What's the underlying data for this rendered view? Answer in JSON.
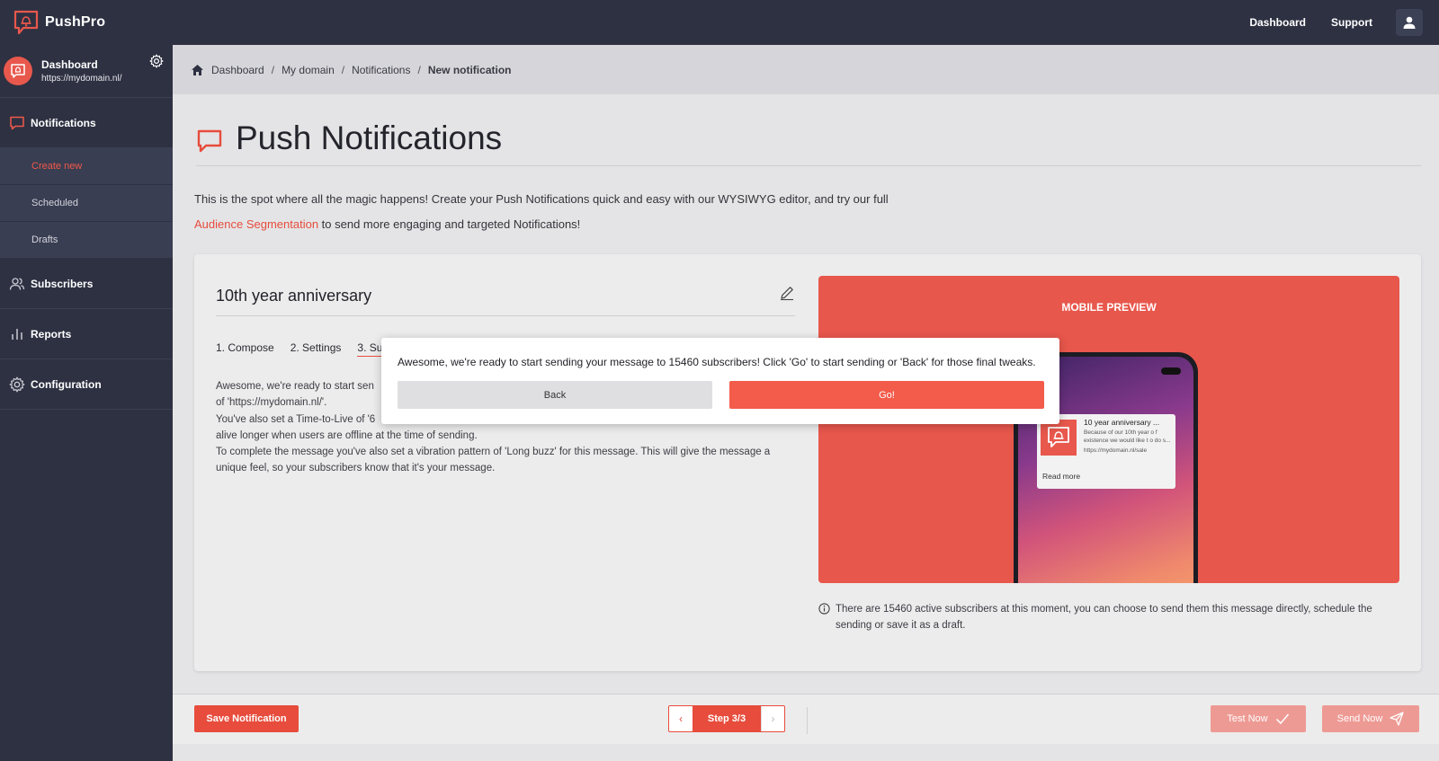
{
  "app": {
    "name": "PushPro"
  },
  "topnav": {
    "dashboard": "Dashboard",
    "support": "Support"
  },
  "sidebar": {
    "site_name": "Dashboard",
    "site_url": "https://mydomain.nl/",
    "sections": [
      {
        "label": "Notifications",
        "icon": "chat-bubble-icon"
      },
      {
        "label": "Subscribers",
        "icon": "users-icon"
      },
      {
        "label": "Reports",
        "icon": "bar-chart-icon"
      },
      {
        "label": "Configuration",
        "icon": "gear-icon"
      }
    ],
    "notification_items": [
      {
        "label": "Create new",
        "active": true
      },
      {
        "label": "Scheduled",
        "active": false
      },
      {
        "label": "Drafts",
        "active": false
      }
    ]
  },
  "breadcrumb": {
    "items": [
      "Dashboard",
      "My domain",
      "Notifications"
    ],
    "current": "New notification",
    "separator": "/"
  },
  "page": {
    "title": "Push Notifications",
    "intro_line1": "This is the spot where all the magic happens! Create your Push Notifications quick and easy with our WYSIWYG editor, and try our full",
    "intro_link": "Audience Segmentation",
    "intro_line2": " to send more engaging and targeted Notifications!"
  },
  "editor": {
    "notification_title": "10th year anniversary",
    "steps": [
      {
        "label": "1. Compose",
        "active": false
      },
      {
        "label": "2. Settings",
        "active": false
      },
      {
        "label": "3. Su",
        "active": true
      }
    ],
    "summary": [
      "Awesome, we're ready to start sen",
      "of 'https://mydomain.nl/'.",
      "You've also set a Time-to-Live of '6",
      "alive longer when users are offline at the time of sending.",
      "To complete the message you've also set a vibration pattern of 'Long buzz' for this message. This will give the message a",
      "unique feel, so your subscribers know that it's your message."
    ]
  },
  "preview": {
    "label": "MOBILE PREVIEW",
    "notif_title": "10 year anniversary ...",
    "notif_body": "Because of our 10th year o f existence we would like t o do s...",
    "notif_url": "https://mydomain.nl/sale",
    "read_more": "Read more"
  },
  "info_text": "There are 15460 active subscribers at this moment, you can choose to send them this message directly, schedule the sending or save it as a draft.",
  "modal": {
    "message": "Awesome, we're ready to start sending your message to 15460 subscribers! Click 'Go' to start sending or 'Back' for those final tweaks.",
    "back": "Back",
    "go": "Go!"
  },
  "bottombar": {
    "save": "Save Notification",
    "step": "Step 3/3",
    "prev_arrow": "‹",
    "next_arrow": "›",
    "test": "Test Now",
    "send": "Send Now"
  },
  "colors": {
    "accent": "#e74c3c",
    "sidebar": "#2e3142",
    "preview_bg": "#e8574c"
  }
}
